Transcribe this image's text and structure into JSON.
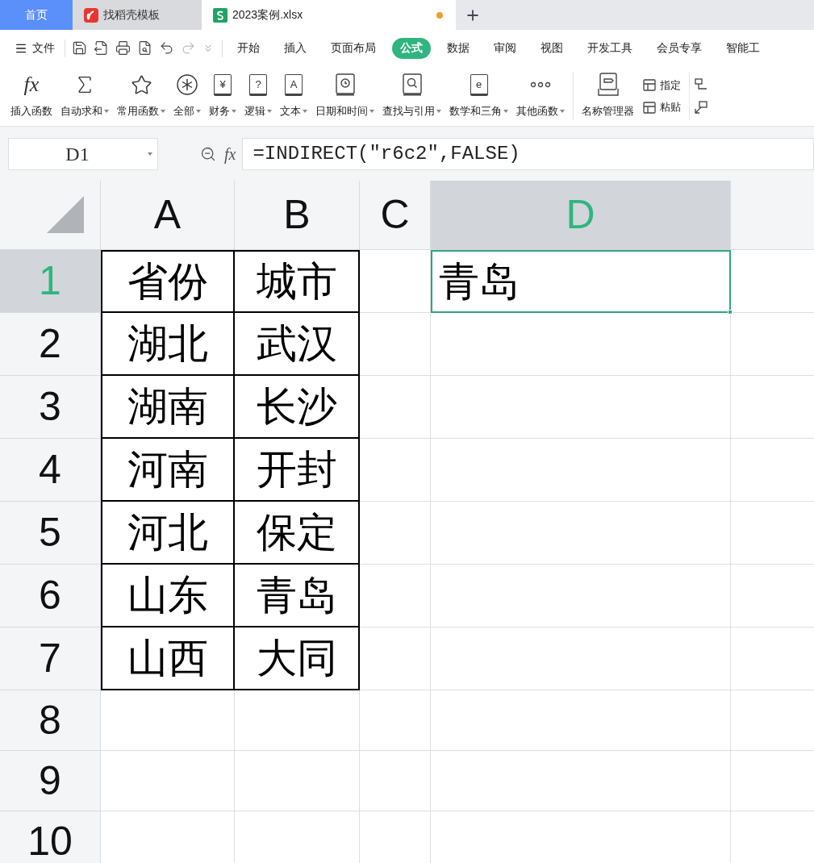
{
  "tabs": [
    {
      "label": "首页",
      "kind": "home",
      "selected": false
    },
    {
      "label": "找稻壳模板",
      "kind": "template",
      "selected": false
    },
    {
      "label": "2023案例.xlsx",
      "kind": "sheet",
      "selected": true,
      "modified": true
    }
  ],
  "menu": {
    "file": "文件",
    "items": [
      {
        "label": "开始",
        "selected": false
      },
      {
        "label": "插入",
        "selected": false
      },
      {
        "label": "页面布局",
        "selected": false
      },
      {
        "label": "公式",
        "selected": true
      },
      {
        "label": "数据",
        "selected": false
      },
      {
        "label": "审阅",
        "selected": false
      },
      {
        "label": "视图",
        "selected": false
      },
      {
        "label": "开发工具",
        "selected": false
      },
      {
        "label": "会员专享",
        "selected": false
      },
      {
        "label": "智能工",
        "selected": false
      }
    ]
  },
  "ribbon": [
    {
      "kind": "fx",
      "glyph": "fx",
      "label": "插入函数",
      "dropdown": false
    },
    {
      "kind": "sigma",
      "label": "自动求和",
      "dropdown": true
    },
    {
      "kind": "star",
      "label": "常用函数",
      "dropdown": true
    },
    {
      "kind": "asterisk",
      "label": "全部",
      "dropdown": true
    },
    {
      "kind": "book",
      "glyph": "¥",
      "label": "财务",
      "dropdown": true
    },
    {
      "kind": "book",
      "glyph": "?",
      "label": "逻辑",
      "dropdown": true
    },
    {
      "kind": "book",
      "glyph": "A",
      "label": "文本",
      "dropdown": true
    },
    {
      "kind": "clock",
      "label": "日期和时间",
      "dropdown": true
    },
    {
      "kind": "search",
      "label": "查找与引用",
      "dropdown": true
    },
    {
      "kind": "book",
      "glyph": "e",
      "label": "数学和三角",
      "dropdown": true
    },
    {
      "kind": "dots",
      "label": "其他函数",
      "dropdown": true
    }
  ],
  "name_tools": {
    "manager": "名称管理器",
    "small": [
      "指定",
      "粘贴"
    ]
  },
  "name_box": "D1",
  "formula_glyph": "fx",
  "formula": "=INDIRECT(″r6c2″,FALSE)",
  "columns": [
    {
      "label": "A",
      "selected": false
    },
    {
      "label": "B",
      "selected": false
    },
    {
      "label": "C",
      "selected": false
    },
    {
      "label": "D",
      "selected": true
    }
  ],
  "rows": [
    {
      "label": "1",
      "selected": true,
      "cells": [
        {
          "text": "省份",
          "bordered": true
        },
        {
          "text": "城市",
          "bordered": true
        },
        null,
        {
          "text": "青岛",
          "active": true
        }
      ]
    },
    {
      "label": "2",
      "selected": false,
      "cells": [
        {
          "text": "湖北",
          "bordered": true
        },
        {
          "text": "武汉",
          "bordered": true
        },
        null,
        null
      ]
    },
    {
      "label": "3",
      "selected": false,
      "cells": [
        {
          "text": "湖南",
          "bordered": true
        },
        {
          "text": "长沙",
          "bordered": true
        },
        null,
        null
      ]
    },
    {
      "label": "4",
      "selected": false,
      "cells": [
        {
          "text": "河南",
          "bordered": true
        },
        {
          "text": "开封",
          "bordered": true
        },
        null,
        null
      ]
    },
    {
      "label": "5",
      "selected": false,
      "cells": [
        {
          "text": "河北",
          "bordered": true
        },
        {
          "text": "保定",
          "bordered": true
        },
        null,
        null
      ]
    },
    {
      "label": "6",
      "selected": false,
      "cells": [
        {
          "text": "山东",
          "bordered": true
        },
        {
          "text": "青岛",
          "bordered": true
        },
        null,
        null
      ]
    },
    {
      "label": "7",
      "selected": false,
      "cells": [
        {
          "text": "山西",
          "bordered": true
        },
        {
          "text": "大同",
          "bordered": true
        },
        null,
        null
      ]
    },
    {
      "label": "8",
      "selected": false,
      "cells": [
        null,
        null,
        null,
        null
      ]
    },
    {
      "label": "9",
      "selected": false,
      "cells": [
        null,
        null,
        null,
        null
      ]
    },
    {
      "label": "10",
      "selected": false,
      "cells": [
        null,
        null,
        null,
        null
      ]
    }
  ]
}
